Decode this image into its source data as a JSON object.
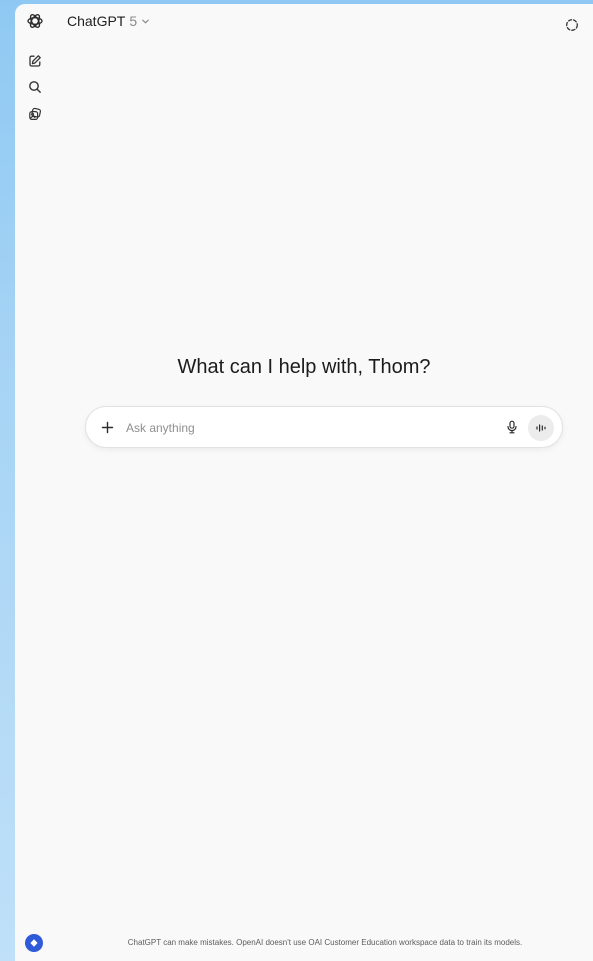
{
  "header": {
    "model_name": "ChatGPT",
    "model_version": "5"
  },
  "main": {
    "greeting": "What can I help with, Thom?"
  },
  "composer": {
    "placeholder": "Ask anything"
  },
  "footer": {
    "disclaimer": "ChatGPT can make mistakes. OpenAI doesn't use OAI Customer Education workspace data to train its models."
  },
  "icons": {
    "logo": "openai-logo-icon",
    "new_chat": "new-chat-icon",
    "search": "search-icon",
    "library": "library-icon",
    "model_chevron": "chevron-down-icon",
    "temporary_chat": "temporary-chat-icon",
    "attach": "plus-icon",
    "dictate": "microphone-icon",
    "voice_mode": "voice-mode-icon",
    "help": "help-icon"
  },
  "colors": {
    "background": "#8fc9f3",
    "window": "#f9f9f9",
    "accent": "#2f5bd8"
  }
}
